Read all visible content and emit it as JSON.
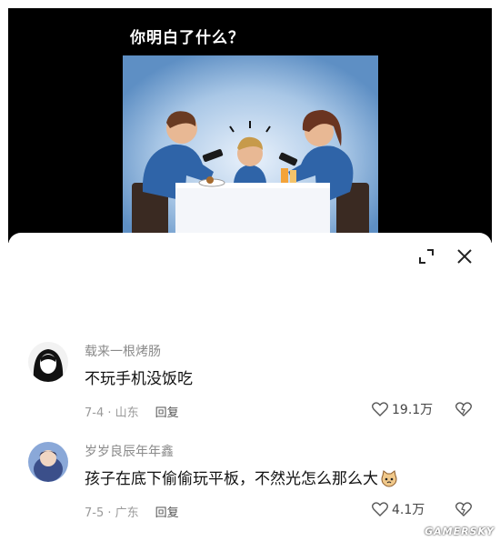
{
  "video": {
    "title": "你明白了什么？"
  },
  "toolbar": {
    "collapse_icon": "collapse-icon",
    "close_icon": "close-icon"
  },
  "comments": [
    {
      "username": "载来一根烤肠",
      "text": "不玩手机没饭吃",
      "date": "7-4",
      "location": "山东",
      "reply_label": "回复",
      "likes": "19.1万"
    },
    {
      "username": "岁岁良辰年年鑫",
      "text": "孩子在底下偷偷玩平板，不然光怎么那么大",
      "date": "7-5",
      "location": "广东",
      "reply_label": "回复",
      "likes": "4.1万"
    }
  ],
  "watermark": "GAMERSKY",
  "colors": {
    "background": "#ffffff",
    "video_bg": "#000000",
    "meta_text": "#9a9a9a"
  }
}
